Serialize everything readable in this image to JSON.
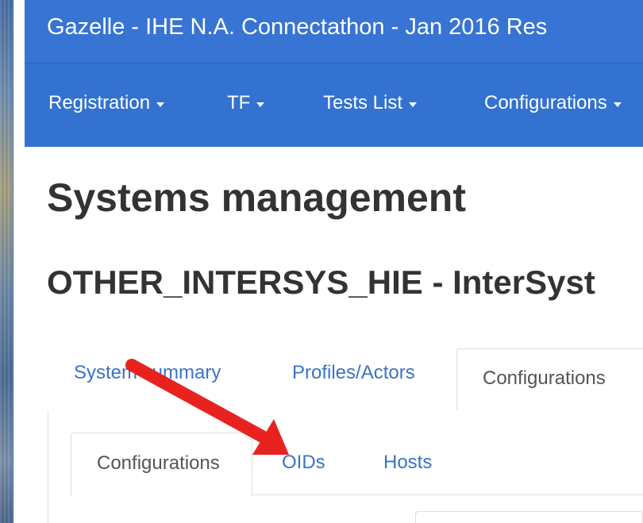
{
  "app": {
    "title": "Gazelle - IHE N.A. Connectathon - Jan 2016 Res"
  },
  "navbar": {
    "items": [
      {
        "label": "Registration",
        "icon": "caret-down-icon"
      },
      {
        "label": "TF",
        "icon": "caret-down-icon"
      },
      {
        "label": "Tests List",
        "icon": "caret-down-icon"
      },
      {
        "label": "Configurations",
        "icon": "caret-down-icon"
      }
    ]
  },
  "page": {
    "title": "Systems management",
    "system_title": "OTHER_INTERSYS_HIE - InterSyst"
  },
  "outer_tabs": {
    "items": [
      {
        "label": "System summary"
      },
      {
        "label": "Profiles/Actors"
      },
      {
        "label": "Configurations",
        "active": true
      }
    ]
  },
  "inner_tabs": {
    "items": [
      {
        "label": "Configurations",
        "active": true
      },
      {
        "label": "OIDs"
      },
      {
        "label": "Hosts"
      }
    ]
  },
  "annotation": {
    "type": "arrow",
    "color": "#e8231f",
    "points_to": "OIDs"
  },
  "colors": {
    "header_bg": "#3774d3",
    "navbar_bg": "#3372d1",
    "link": "#3b73c4",
    "text": "#333333",
    "border": "#dddddd"
  }
}
